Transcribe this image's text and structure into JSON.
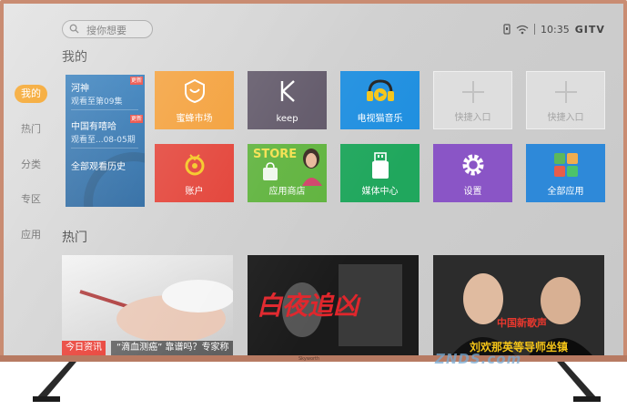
{
  "topbar": {
    "search_placeholder": "搜你想要",
    "time": "10:35",
    "brand": "GITV"
  },
  "sections": {
    "mine": "我的",
    "hot": "热门"
  },
  "nav": {
    "items": [
      {
        "label": "我的",
        "active": true
      },
      {
        "label": "热门",
        "active": false
      },
      {
        "label": "分类",
        "active": false
      },
      {
        "label": "专区",
        "active": false
      },
      {
        "label": "应用",
        "active": false
      }
    ]
  },
  "history": {
    "items": [
      {
        "title": "河神",
        "sub": "观看至第09集",
        "badge": "更新"
      },
      {
        "title": "中国有嘻哈",
        "sub": "观看至...08-05期",
        "badge": "更新"
      }
    ],
    "all_label": "全部观看历史"
  },
  "apps": [
    {
      "label": "蜜蜂市场",
      "icon": "bee-shield-icon",
      "color": "#f39a2e"
    },
    {
      "label": "keep",
      "icon": "keep-k-icon",
      "color": "#5e5566"
    },
    {
      "label": "电视猫音乐",
      "icon": "tv-cat-music-icon",
      "color": "#1f8fe0"
    },
    {
      "label": "快捷入口",
      "icon": "plus-icon",
      "color": ""
    },
    {
      "label": "快捷入口",
      "icon": "plus-icon",
      "color": ""
    },
    {
      "label": "账户",
      "icon": "account-icon",
      "color": "#e23a2f"
    },
    {
      "label": "应用商店",
      "icon": "store-icon",
      "color": "#5fb33d",
      "overlay": "STORE"
    },
    {
      "label": "媒体中心",
      "icon": "usb-icon",
      "color": "#20a75d"
    },
    {
      "label": "设置",
      "icon": "gear-icon",
      "color": "#8a55c6"
    },
    {
      "label": "全部应用",
      "icon": "apps-grid-icon",
      "color": "#2e89d9"
    }
  ],
  "hot": [
    {
      "tag": "今日资讯",
      "caption": "“滴血测癌” 靠谱吗？专家称"
    },
    {
      "title_art": "白夜追凶"
    },
    {
      "title_art": "中国新歌声",
      "caption": "刘欢那英等导师坐镇"
    }
  ],
  "watermark": "ZNDS.com",
  "brand_logo": "Skyworth",
  "colors": {
    "accent": "#f39200",
    "frame": "#c98c72"
  }
}
